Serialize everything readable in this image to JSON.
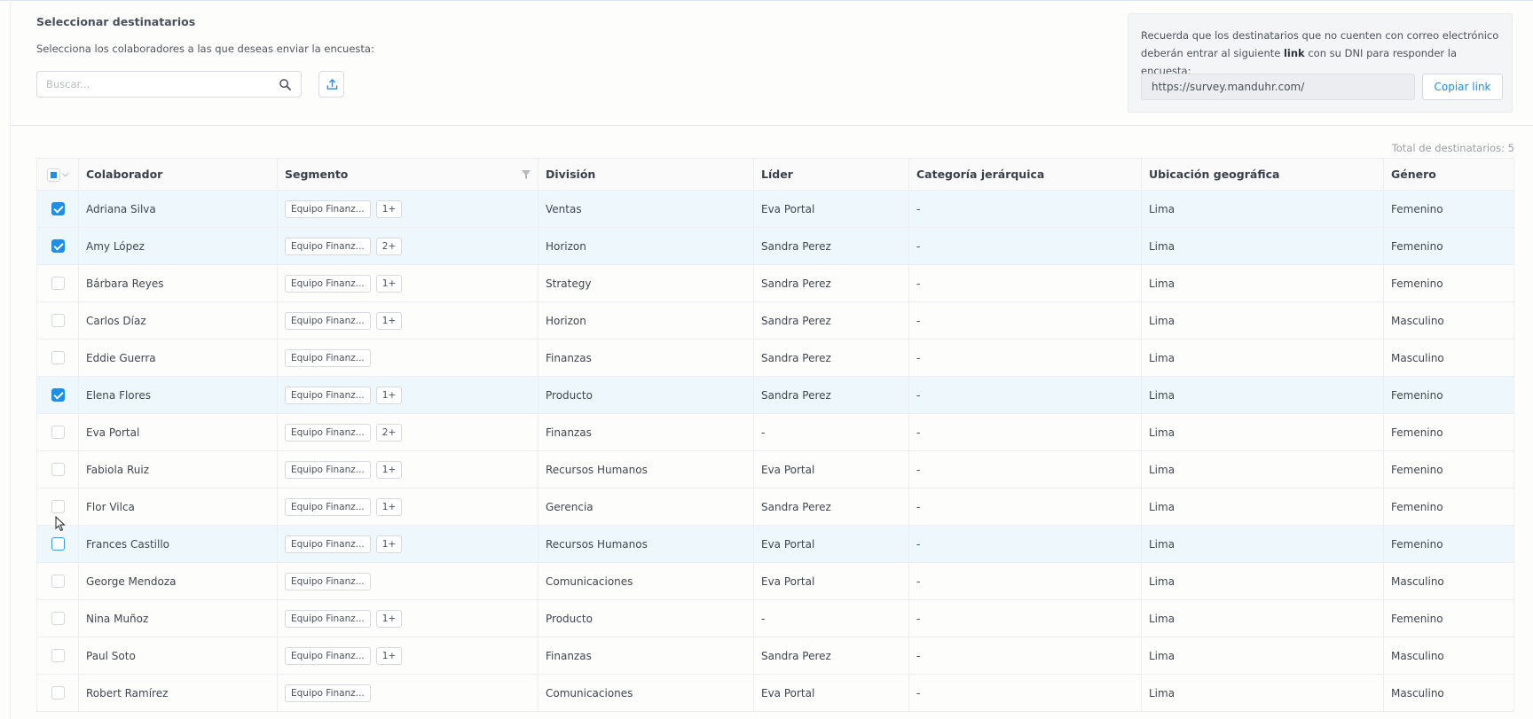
{
  "header": {
    "title": "Seleccionar destinatarios",
    "subtitle": "Selecciona los colaboradores a las que deseas enviar la encuesta:",
    "search_placeholder": "Buscar..."
  },
  "notice": {
    "text_before": "Recuerda que los destinatarios que no cuenten con correo electrónico deberán entrar al siguiente ",
    "text_bold": "link",
    "text_after": " con su DNI para responder la encuesta:",
    "link": "https://survey.manduhr.com/",
    "copy_label": "Copiar link"
  },
  "table": {
    "total_label": "Total de destinatarios: 5",
    "columns": [
      "Colaborador",
      "Segmento",
      "División",
      "Líder",
      "Categoría jerárquica",
      "Ubicación geográfica",
      "Género"
    ],
    "rows": [
      {
        "name": "Adriana Silva",
        "tag": "Equipo Finanz...",
        "more": "1+",
        "division": "Ventas",
        "leader": "Eva Portal",
        "category": "-",
        "location": "Lima",
        "gender": "Femenino",
        "checked": true
      },
      {
        "name": "Amy López",
        "tag": "Equipo Finanz...",
        "more": "2+",
        "division": "Horizon",
        "leader": "Sandra Perez",
        "category": "-",
        "location": "Lima",
        "gender": "Femenino",
        "checked": true
      },
      {
        "name": "Bárbara Reyes",
        "tag": "Equipo Finanz...",
        "more": "1+",
        "division": "Strategy",
        "leader": "Sandra Perez",
        "category": "-",
        "location": "Lima",
        "gender": "Femenino",
        "checked": false
      },
      {
        "name": "Carlos Díaz",
        "tag": "Equipo Finanz...",
        "more": "1+",
        "division": "Horizon",
        "leader": "Sandra Perez",
        "category": "-",
        "location": "Lima",
        "gender": "Masculino",
        "checked": false
      },
      {
        "name": "Eddie Guerra",
        "tag": "Equipo Finanz...",
        "more": "",
        "division": "Finanzas",
        "leader": "Sandra Perez",
        "category": "-",
        "location": "Lima",
        "gender": "Masculino",
        "checked": false
      },
      {
        "name": "Elena Flores",
        "tag": "Equipo Finanz...",
        "more": "1+",
        "division": "Producto",
        "leader": "Sandra Perez",
        "category": "-",
        "location": "Lima",
        "gender": "Femenino",
        "checked": true
      },
      {
        "name": "Eva Portal",
        "tag": "Equipo Finanz...",
        "more": "2+",
        "division": "Finanzas",
        "leader": "-",
        "category": "-",
        "location": "Lima",
        "gender": "Femenino",
        "checked": false
      },
      {
        "name": "Fabiola Ruiz",
        "tag": "Equipo Finanz...",
        "more": "1+",
        "division": "Recursos Humanos",
        "leader": "Eva Portal",
        "category": "-",
        "location": "Lima",
        "gender": "Femenino",
        "checked": false
      },
      {
        "name": "Flor Vilca",
        "tag": "Equipo Finanz...",
        "more": "1+",
        "division": "Gerencia",
        "leader": "Sandra Perez",
        "category": "-",
        "location": "Lima",
        "gender": "Femenino",
        "checked": false
      },
      {
        "name": "Frances Castillo",
        "tag": "Equipo Finanz...",
        "more": "1+",
        "division": "Recursos Humanos",
        "leader": "Eva Portal",
        "category": "-",
        "location": "Lima",
        "gender": "Femenino",
        "checked": false,
        "hover": true
      },
      {
        "name": "George Mendoza",
        "tag": "Equipo Finanz...",
        "more": "",
        "division": "Comunicaciones",
        "leader": "Eva Portal",
        "category": "-",
        "location": "Lima",
        "gender": "Masculino",
        "checked": false
      },
      {
        "name": "Nina Muñoz",
        "tag": "Equipo Finanz...",
        "more": "1+",
        "division": "Producto",
        "leader": "-",
        "category": "-",
        "location": "Lima",
        "gender": "Femenino",
        "checked": false
      },
      {
        "name": "Paul Soto",
        "tag": "Equipo Finanz...",
        "more": "1+",
        "division": "Finanzas",
        "leader": "Sandra Perez",
        "category": "-",
        "location": "Lima",
        "gender": "Masculino",
        "checked": false
      },
      {
        "name": "Robert Ramírez",
        "tag": "Equipo Finanz...",
        "more": "",
        "division": "Comunicaciones",
        "leader": "Eva Portal",
        "category": "-",
        "location": "Lima",
        "gender": "Masculino",
        "checked": false
      }
    ]
  },
  "colors": {
    "accent": "#1e8fe8",
    "selected_row": "#eef7fc",
    "link_button_text": "#2c8ad9"
  },
  "icons": {
    "search": "search-icon",
    "upload": "upload-icon",
    "filter": "filter-icon",
    "caret": "chevron-down-icon"
  }
}
